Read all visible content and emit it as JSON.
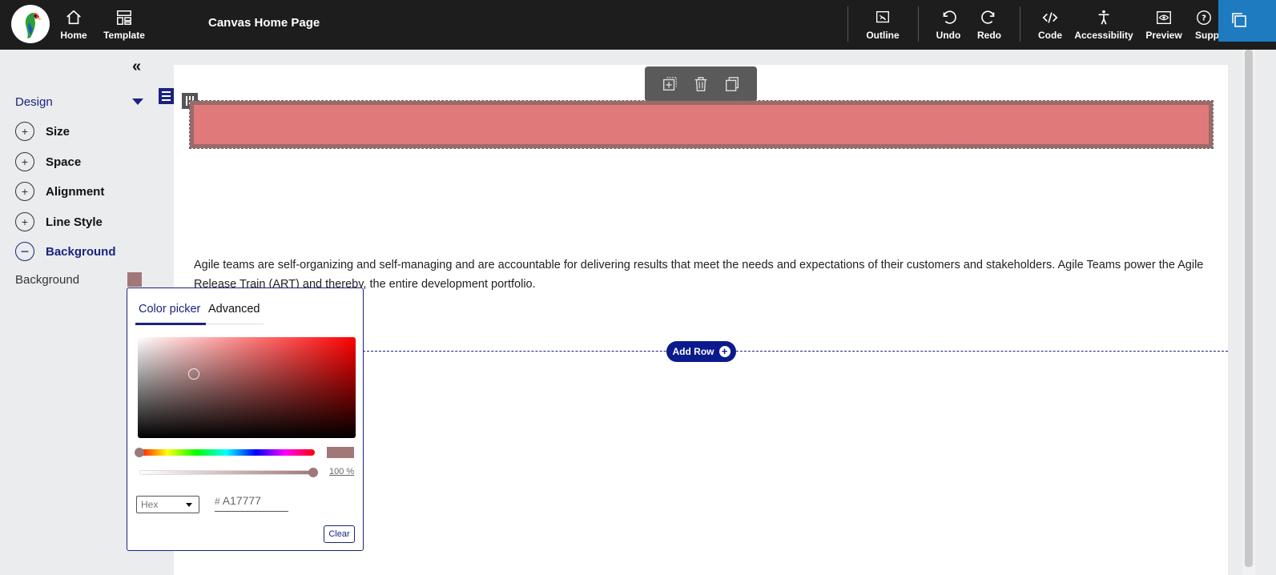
{
  "header": {
    "title": "Canvas Home Page",
    "nav_left": [
      {
        "label": "Home",
        "icon": "home-icon"
      },
      {
        "label": "Template",
        "icon": "template-icon"
      }
    ],
    "nav_right": [
      {
        "label": "Outline",
        "icon": "outline-icon"
      },
      {
        "label": "Undo",
        "icon": "undo-icon"
      },
      {
        "label": "Redo",
        "icon": "redo-icon"
      },
      {
        "label": "Code",
        "icon": "code-icon"
      },
      {
        "label": "Accessibility",
        "icon": "accessibility-icon"
      },
      {
        "label": "Preview",
        "icon": "preview-icon"
      },
      {
        "label": "Supp",
        "icon": "help-icon"
      }
    ]
  },
  "sidebar": {
    "collapse_glyph": "«",
    "section": "Design",
    "items": [
      {
        "label": "Size",
        "state": "+"
      },
      {
        "label": "Space",
        "state": "+"
      },
      {
        "label": "Alignment",
        "state": "+"
      },
      {
        "label": "Line Style",
        "state": "+"
      },
      {
        "label": "Background",
        "state": "−"
      }
    ],
    "background_label": "Background",
    "background_color": "#a17777"
  },
  "canvas": {
    "paragraph": "Agile teams are self-organizing and self-managing and are accountable for delivering results that meet the needs and expectations of their customers and stakeholders. Agile Teams power the Agile Release Train (ART) and thereby, the entire development portfolio.",
    "add_row_label": "Add Row",
    "add_row_plus": "+",
    "bar_color": "#e07a7a"
  },
  "color_picker": {
    "tabs": [
      "Color picker",
      "Advanced"
    ],
    "active_tab": "Color picker",
    "alpha_value": "100 %",
    "format": "Hex",
    "hash": "#",
    "hex_value": "A17777",
    "clear_label": "Clear",
    "selected_color": "#a17777"
  },
  "colors": {
    "accent": "#1a237e",
    "topbar": "#1d1d1d",
    "corner": "#1e7bbf"
  }
}
